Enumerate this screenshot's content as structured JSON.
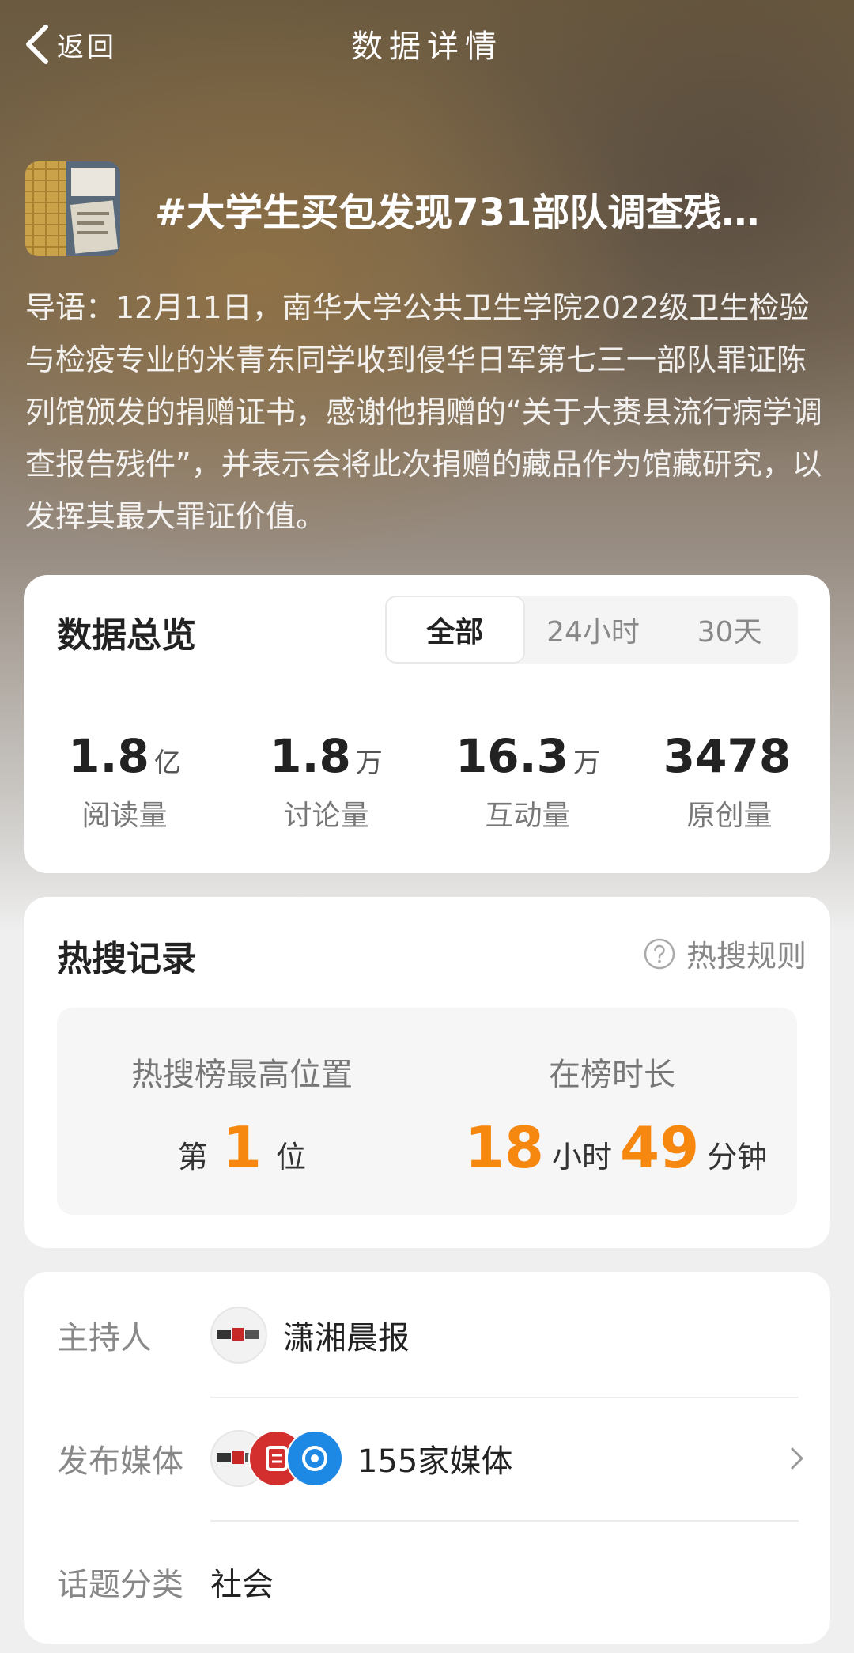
{
  "nav": {
    "back_label": "返回",
    "title": "数据详情"
  },
  "topic": {
    "title": "#大学生买包发现731部队调查残…",
    "intro": "导语：12月11日，南华大学公共卫生学院2022级卫生检验与检疫专业的米青东同学收到侵华日军第七三一部队罪证陈列馆颁发的捐赠证书，感谢他捐赠的“关于大赉县流行病学调查报告残件”，并表示会将此次捐赠的藏品作为馆藏研究，以发挥其最大罪证价值。"
  },
  "overview": {
    "title": "数据总览",
    "tabs": [
      "全部",
      "24小时",
      "30天"
    ],
    "active_tab": "全部",
    "stats": [
      {
        "value": "1.8",
        "unit": "亿",
        "label": "阅读量"
      },
      {
        "value": "1.8",
        "unit": "万",
        "label": "讨论量"
      },
      {
        "value": "16.3",
        "unit": "万",
        "label": "互动量"
      },
      {
        "value": "3478",
        "unit": "",
        "label": "原创量"
      }
    ]
  },
  "hot": {
    "title": "热搜记录",
    "rules_label": "热搜规则",
    "peak_label": "热搜榜最高位置",
    "peak_prefix": "第",
    "peak_value": "1",
    "peak_suffix": "位",
    "duration_label": "在榜时长",
    "hours_value": "18",
    "hours_unit": "小时",
    "minutes_value": "49",
    "minutes_unit": "分钟"
  },
  "info": {
    "host_label": "主持人",
    "host_name": "潇湘晨报",
    "media_label": "发布媒体",
    "media_count": "155家媒体",
    "category_label": "话题分类",
    "category_value": "社会"
  },
  "colors": {
    "accent": "#f6870f",
    "card_bg": "#ffffff",
    "page_bg": "#efefef"
  }
}
